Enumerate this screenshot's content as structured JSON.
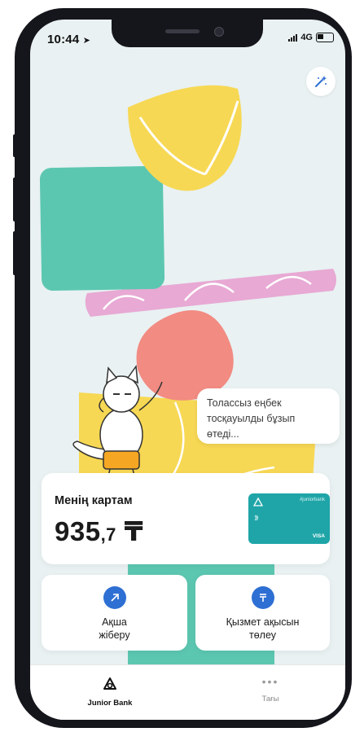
{
  "status_bar": {
    "time": "10:44",
    "signal": "4G"
  },
  "header": {
    "magic_icon": "sparkle-wand-icon"
  },
  "speech_bubble": {
    "text": "Толассыз еңбек тосқауылды бұзып өтеді..."
  },
  "card": {
    "title": "Менің картам",
    "balance_main": "935",
    "balance_decimal": ",7",
    "currency": "₸",
    "mini_card": {
      "brand": "#juniorbank",
      "network": "VISA"
    }
  },
  "actions": [
    {
      "label_line1": "Ақша",
      "label_line2": "жіберу",
      "icon": "arrow-up-right-icon"
    },
    {
      "label_line1": "Қызмет ақысын",
      "label_line2": "төлеу",
      "icon": "tenge-icon"
    }
  ],
  "tabs": [
    {
      "label": "Junior Bank",
      "icon": "junior-bank-logo-icon",
      "active": true
    },
    {
      "label": "Тағы",
      "icon": "more-dots-icon",
      "active": false
    }
  ],
  "colors": {
    "background": "#e9f1f2",
    "accent_blue": "#2e6fd3",
    "card_teal": "#1fa5a8",
    "yellow": "#f7d854",
    "mint": "#5cc7b1",
    "pink": "#e8a9d4",
    "salmon": "#f28b82"
  }
}
